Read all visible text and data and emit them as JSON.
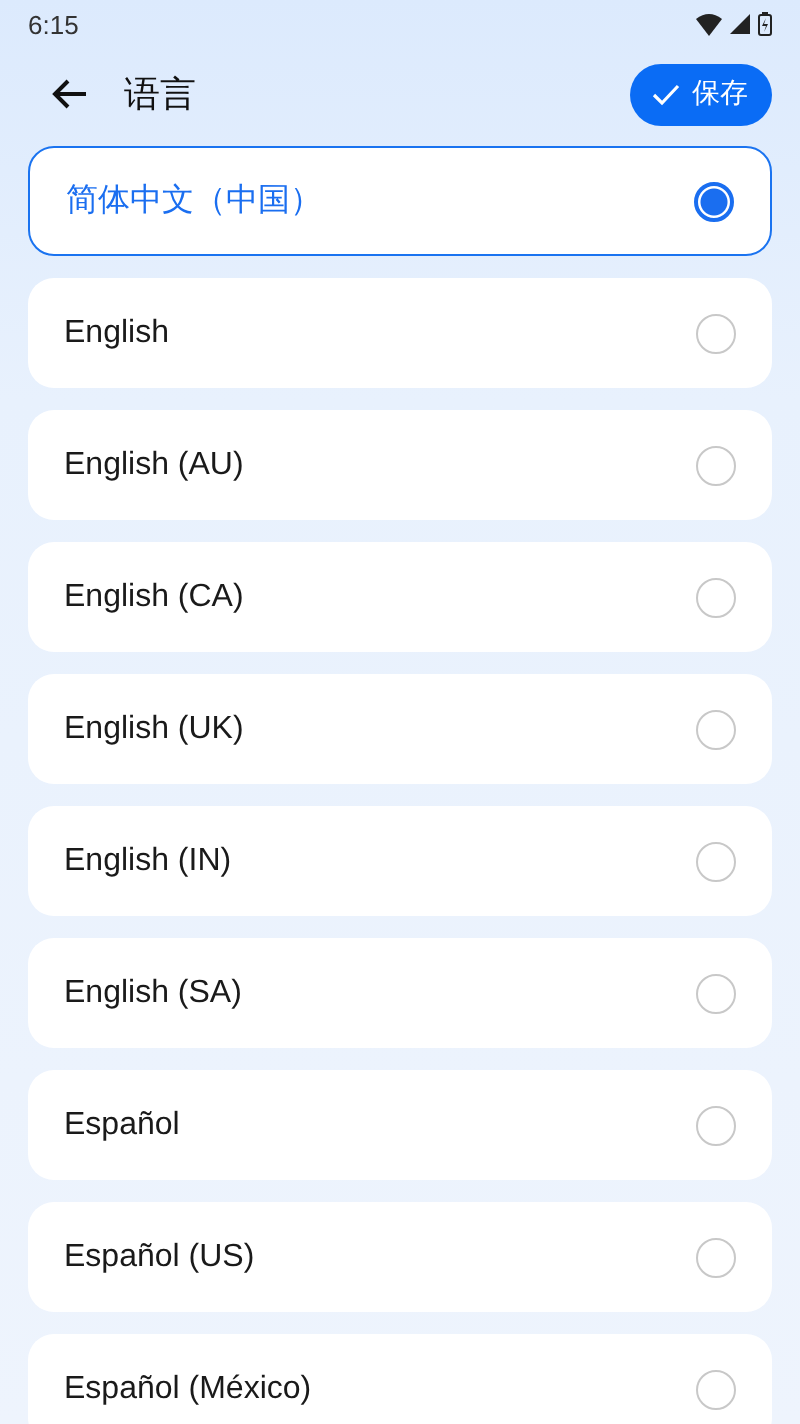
{
  "status_bar": {
    "time": "6:15"
  },
  "header": {
    "title": "语言",
    "save_button": "保存"
  },
  "languages": [
    {
      "label": "简体中文（中国）",
      "selected": true
    },
    {
      "label": "English",
      "selected": false
    },
    {
      "label": "English (AU)",
      "selected": false
    },
    {
      "label": "English (CA)",
      "selected": false
    },
    {
      "label": "English (UK)",
      "selected": false
    },
    {
      "label": "English (IN)",
      "selected": false
    },
    {
      "label": "English (SA)",
      "selected": false
    },
    {
      "label": "Español",
      "selected": false
    },
    {
      "label": "Español (US)",
      "selected": false
    },
    {
      "label": "Español (México)",
      "selected": false
    }
  ]
}
